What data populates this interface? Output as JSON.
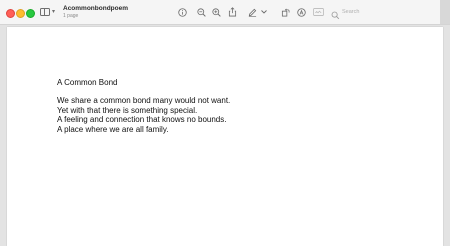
{
  "window": {
    "title": "Acommonbondpoem",
    "subtitle": "1 page"
  },
  "toolbar": {
    "icons": [
      "sidebar-icon",
      "info-icon",
      "zoom-out-icon",
      "zoom-in-icon",
      "share-icon",
      "markup-pen-icon",
      "rotate-icon",
      "annotate-icon",
      "form-icon",
      "search-icon"
    ],
    "search_placeholder": "Search"
  },
  "document": {
    "title": "A Common Bond",
    "lines": [
      "We share a common bond many would not want.",
      "Yet with that there is something special.",
      "A feeling and connection that knows no bounds.",
      "A place where we are all family."
    ]
  },
  "colors": {
    "close": "#ff5f57",
    "minimize": "#febc2e",
    "maximize": "#28c840"
  }
}
